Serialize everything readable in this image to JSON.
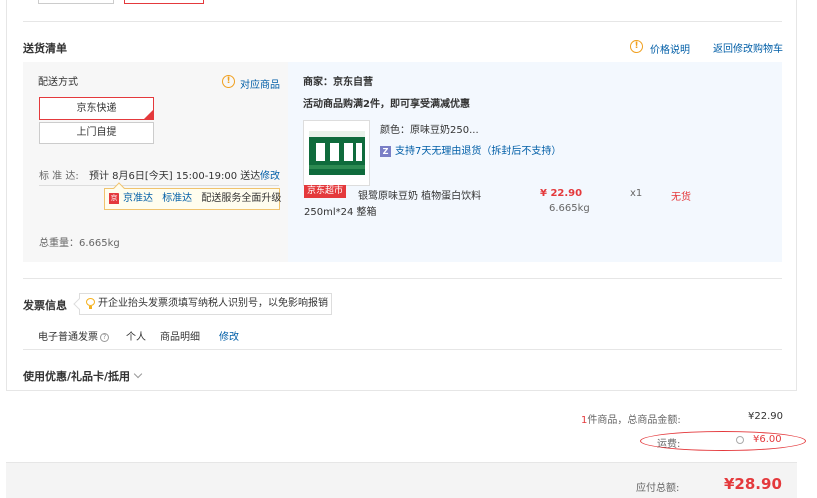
{
  "delivery": {
    "section_title": "送货清单",
    "price_note": "价格说明",
    "back_to_cart": "返回修改购物车",
    "shipping_method_label": "配送方式",
    "matching_products": "对应商品",
    "options": [
      "京东快递",
      "上门自提"
    ],
    "standard_label": "标 准 达:",
    "eta": "预计 8月6日[今天] 15:00-19:00 送达",
    "modify": "修改",
    "tip_brand1": "京准达",
    "tip_brand2": "标准达",
    "tip_text": "配送服务全面升级",
    "total_weight": "总重量：6.665kg"
  },
  "shop": {
    "merchant": "商家：京东自营",
    "promo": "活动商品购满2件，即可享受满减优惠",
    "item": {
      "color": "颜色：原味豆奶250...",
      "return_policy": "支持7天无理由退货（拆封后不支持）",
      "return_icon": "Z",
      "badge": "京东超市",
      "name_line1": "银鹭原味豆奶 植物蛋白饮料",
      "name_line2": "250ml*24 整箱",
      "price": "¥ 22.90",
      "weight": "6.665kg",
      "qty": "x1",
      "stock": "无货"
    }
  },
  "invoice": {
    "title": "发票信息",
    "tip": "开企业抬头发票须填写纳税人识别号，以免影响报销",
    "type": "电子普通发票",
    "holder": "个人",
    "content": "商品明细",
    "modify": "修改"
  },
  "coupon": {
    "title": "使用优惠/礼品卡/抵用"
  },
  "summary": {
    "count": "1",
    "count_suffix": "件商品，总商品金额:",
    "goods_total": "¥22.90",
    "freight_label": "运费:",
    "freight": "¥6.00",
    "payable_label": "应付总额:",
    "payable": "¥28.90"
  },
  "colors": {
    "accent_red": "#e4393c",
    "link_blue": "#005ea7",
    "info_orange": "#f0a020"
  }
}
